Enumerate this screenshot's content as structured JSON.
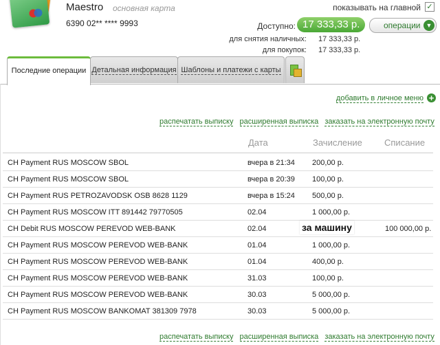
{
  "card": {
    "name": "Maestro",
    "type_label": "основная карта",
    "number": "6390 02** **** 9993"
  },
  "show_on_main": {
    "label": "показывать на главной",
    "checked": true
  },
  "balance": {
    "available_label": "Доступно:",
    "available_value": "17 333,33 р.",
    "cash_label": "для снятия наличных:",
    "cash_value": "17 333,33 р.",
    "purchases_label": "для покупок:",
    "purchases_value": "17 333,33 р."
  },
  "operations_button": {
    "label": "операции"
  },
  "tabs": [
    {
      "label": "Последние операции",
      "active": true
    },
    {
      "label": "Детальная информация",
      "active": false
    },
    {
      "label": "Шаблоны и платежи с карты",
      "active": false
    }
  ],
  "add_to_menu": "добавить в личное меню",
  "links": [
    "распечатать выписку",
    "расширенная выписка",
    "заказать на электронную почту"
  ],
  "table": {
    "headers": {
      "date": "Дата",
      "credit": "Зачисление",
      "debit": "Списание"
    },
    "rows": [
      {
        "desc": "CH Payment RUS MOSCOW SBOL",
        "date": "вчера в 21:34",
        "credit": "200,00 р.",
        "debit": ""
      },
      {
        "desc": "CH Payment RUS MOSCOW SBOL",
        "date": "вчера в 20:39",
        "credit": "100,00 р.",
        "debit": ""
      },
      {
        "desc": "CH Payment RUS PETROZAVODSK OSB 8628 1129",
        "date": "вчера в 15:24",
        "credit": "500,00 р.",
        "debit": ""
      },
      {
        "desc": "CH Payment RUS MOSCOW ITT 891442 79770505",
        "date": "02.04",
        "credit": "1 000,00 р.",
        "debit": ""
      },
      {
        "desc": "CH Debit RUS MOSCOW PEREVOD WEB-BANK",
        "date": "02.04",
        "credit": "",
        "debit": "100 000,00 р."
      },
      {
        "desc": "CH Payment RUS MOSCOW PEREVOD WEB-BANK",
        "date": "01.04",
        "credit": "1 000,00 р.",
        "debit": ""
      },
      {
        "desc": "CH Payment RUS MOSCOW PEREVOD WEB-BANK",
        "date": "01.04",
        "credit": "400,00 р.",
        "debit": ""
      },
      {
        "desc": "CH Payment RUS MOSCOW PEREVOD WEB-BANK",
        "date": "31.03",
        "credit": "100,00 р.",
        "debit": ""
      },
      {
        "desc": "CH Payment RUS MOSCOW PEREVOD WEB-BANK",
        "date": "30.03",
        "credit": "5 000,00 р.",
        "debit": ""
      },
      {
        "desc": "CH Payment RUS MOSCOW BANKOMAT 381309 7978",
        "date": "30.03",
        "credit": "5 000,00 р.",
        "debit": ""
      }
    ]
  },
  "overlay_note": "за машину"
}
